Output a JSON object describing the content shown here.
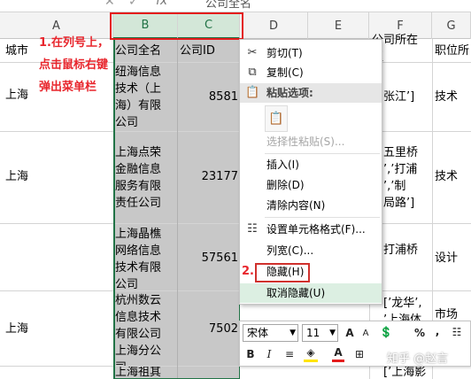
{
  "formula_bar": {
    "value": "公司全名"
  },
  "columns": [
    "A",
    "B",
    "C",
    "D",
    "E",
    "F",
    "G"
  ],
  "header_row": {
    "a": "城市",
    "b": "公司全名",
    "c": "公司ID",
    "f": "公司所在\n区",
    "g": "职位所"
  },
  "rows": [
    {
      "city": "上海",
      "name": "纽海信息\n技术（上\n海）有限\n公司",
      "id": "8581",
      "f": "张江’]",
      "g": "技术"
    },
    {
      "city": "上海",
      "name": "上海点荣\n金融信息\n服务有限\n责任公司",
      "id": "23177",
      "f": "五里桥\n’,’打浦\n’,’制\n局路’]",
      "g": "技术"
    },
    {
      "city": "",
      "name": "上海晶樵\n网络信息\n技术有限\n公司",
      "id": "57561",
      "f": "打浦桥",
      "g": "设计"
    },
    {
      "city": "上海",
      "name": "杭州数云\n信息技术\n有限公司\n上海分公\n司",
      "id": "7502",
      "f": "[’龙华’,\n’上海体",
      "g": "市场"
    },
    {
      "city": "",
      "name": "上海祖其",
      "id": "",
      "f": "[’上海影",
      "g": ""
    }
  ],
  "annotations": {
    "step1": "1.在列号上，\n点击鼠标右键\n弹出菜单栏",
    "step2": "2."
  },
  "context_menu": {
    "cut": "剪切(T)",
    "copy": "复制(C)",
    "paste_options": "粘贴选项:",
    "paste_special": "选择性粘贴(S)...",
    "insert": "插入(I)",
    "delete": "删除(D)",
    "clear": "清除内容(N)",
    "format_cells": "设置单元格格式(F)...",
    "column_width": "列宽(C)...",
    "hide": "隐藏(H)",
    "unhide": "取消隐藏(U)"
  },
  "mini_toolbar": {
    "font": "宋体",
    "size": "11",
    "grow": "A",
    "shrink": "A",
    "percent": "%",
    "comma": ",",
    "bold": "B",
    "italic": "I",
    "font_color": "A"
  },
  "watermark": "知乎 @赵言",
  "colors": {
    "accent": "#217346",
    "annotation_red": "#e8252c",
    "selection": "#c8c8c8"
  }
}
